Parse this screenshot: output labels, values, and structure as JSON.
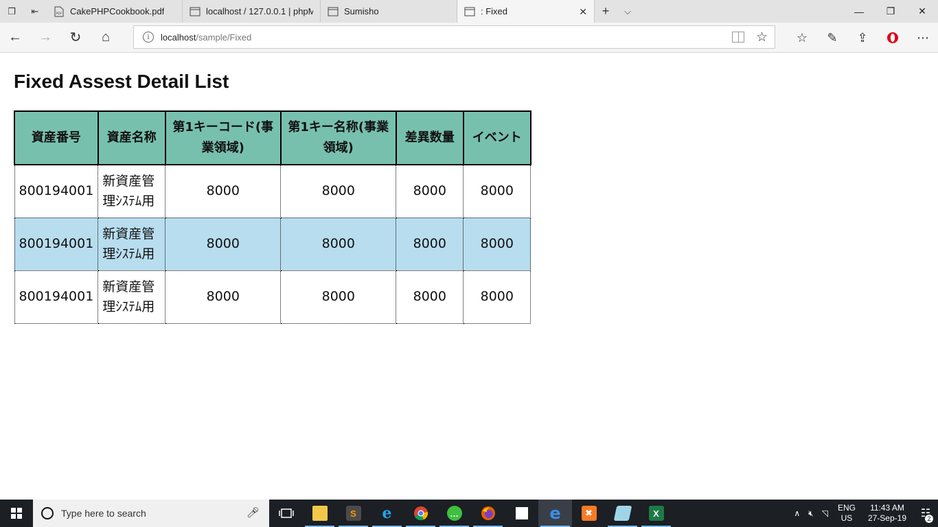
{
  "tabs": [
    {
      "label": "CakePHPCookbook.pdf",
      "icon": "pdf-icon"
    },
    {
      "label": "localhost / 127.0.0.1 | phpM",
      "icon": "page-icon"
    },
    {
      "label": "Sumisho",
      "icon": "page-icon"
    },
    {
      "label": ": Fixed",
      "icon": "page-icon",
      "active": true
    }
  ],
  "address": {
    "host": "localhost",
    "path": "/sample/Fixed"
  },
  "page": {
    "title": "Fixed Assest Detail List"
  },
  "table": {
    "headers": [
      "資産番号",
      "資産名称",
      "第1キーコード(事業領域)",
      "第1キー名称(事業領域)",
      "差異数量",
      "イベント"
    ],
    "rows": [
      [
        "800194001",
        "新資産管理ｼｽﾃﾑ用",
        "8000",
        "8000",
        "8000",
        "8000"
      ],
      [
        "800194001",
        "新資産管理ｼｽﾃﾑ用",
        "8000",
        "8000",
        "8000",
        "8000"
      ],
      [
        "800194001",
        "新資産管理ｼｽﾃﾑ用",
        "8000",
        "8000",
        "8000",
        "8000"
      ]
    ],
    "colors": {
      "header_bg": "#78c0ae",
      "alt_row_bg": "#b8ddef"
    }
  },
  "taskbar": {
    "search_placeholder": "Type here to search",
    "lang_top": "ENG",
    "lang_bottom": "US",
    "time": "11:43 AM",
    "date": "27-Sep-19",
    "notification_count": "2"
  }
}
